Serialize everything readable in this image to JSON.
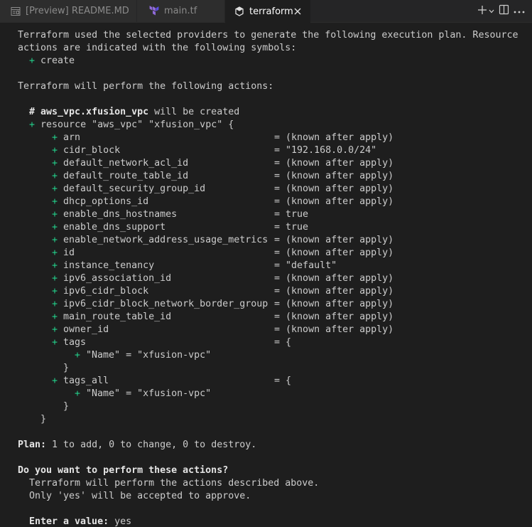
{
  "tabs": [
    {
      "label": "[Preview] README.MD",
      "icon": "preview-icon",
      "active": false
    },
    {
      "label": "main.tf",
      "icon": "terraform-icon",
      "active": false
    },
    {
      "label": "terraform",
      "icon": "terminal-icon",
      "active": true
    }
  ],
  "terminal": {
    "intro_1": "Terraform used the selected providers to generate the following execution plan. Resource",
    "intro_2": "actions are indicated with the following symbols:",
    "symbol_create": "create",
    "perform": "Terraform will perform the following actions:",
    "resource_comment_hash": "# ",
    "resource_address": "aws_vpc.xfusion_vpc",
    "resource_comment_tail": " will be created",
    "resource_decl": "resource \"aws_vpc\" \"xfusion_vpc\" {",
    "attributes": [
      {
        "name": "arn",
        "value": "= (known after apply)"
      },
      {
        "name": "cidr_block",
        "value": "= \"192.168.0.0/24\""
      },
      {
        "name": "default_network_acl_id",
        "value": "= (known after apply)"
      },
      {
        "name": "default_route_table_id",
        "value": "= (known after apply)"
      },
      {
        "name": "default_security_group_id",
        "value": "= (known after apply)"
      },
      {
        "name": "dhcp_options_id",
        "value": "= (known after apply)"
      },
      {
        "name": "enable_dns_hostnames",
        "value": "= true"
      },
      {
        "name": "enable_dns_support",
        "value": "= true"
      },
      {
        "name": "enable_network_address_usage_metrics",
        "value": "= (known after apply)"
      },
      {
        "name": "id",
        "value": "= (known after apply)"
      },
      {
        "name": "instance_tenancy",
        "value": "= \"default\""
      },
      {
        "name": "ipv6_association_id",
        "value": "= (known after apply)"
      },
      {
        "name": "ipv6_cidr_block",
        "value": "= (known after apply)"
      },
      {
        "name": "ipv6_cidr_block_network_border_group",
        "value": "= (known after apply)"
      },
      {
        "name": "main_route_table_id",
        "value": "= (known after apply)"
      },
      {
        "name": "owner_id",
        "value": "= (known after apply)"
      },
      {
        "name": "tags",
        "value": "= {"
      }
    ],
    "tag_entry": "\"Name\" = \"xfusion-vpc\"",
    "close_brace": "}",
    "tags_all": {
      "name": "tags_all",
      "value": "= {"
    },
    "plan_label": "Plan:",
    "plan_text": " 1 to add, 0 to change, 0 to destroy.",
    "confirm_question": "Do you want to perform these actions?",
    "confirm_line1": "Terraform will perform the actions described above.",
    "confirm_line2": "Only 'yes' will be accepted to approve.",
    "enter_label": "Enter a value:",
    "enter_value": " yes",
    "plus_symbol": "+"
  },
  "colors": {
    "background": "#1e1e1e",
    "plus_green": "#23d18b",
    "text": "#cccccc"
  }
}
